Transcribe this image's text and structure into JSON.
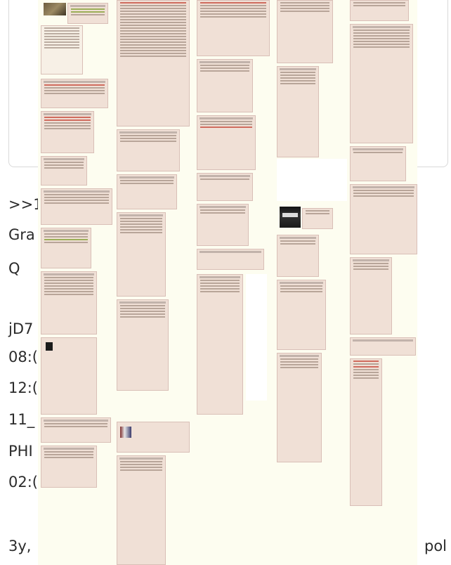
{
  "background_text": {
    "line1": ">>1",
    "line2": "Gra",
    "line3": "Q",
    "line4": "jD7",
    "line5": "08:(",
    "line6": "12:(",
    "line7": "11_",
    "line8": "PHI",
    "line9": "02:(",
    "footer_left": "3y,",
    "footer_right": "pol"
  },
  "colors": {
    "post_bg": "#f0e0d6",
    "post_border": "#d9bfb7",
    "page_bg": "#fdfdf0",
    "greentext": "#789922"
  },
  "image": {
    "description_icon": "forum-thread-collage-image"
  }
}
